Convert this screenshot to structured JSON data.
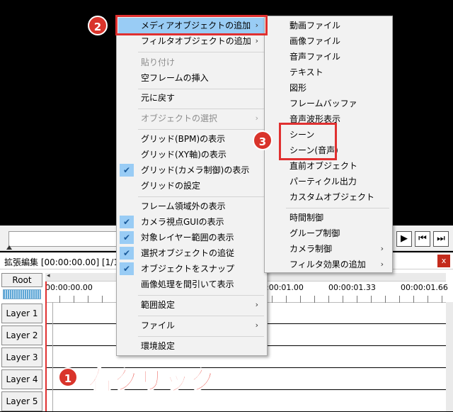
{
  "timeline": {
    "title": "拡張編集 [00:00:00.00] [1/1]",
    "close": "x",
    "root": "Root",
    "ticks": [
      "00:00:00.00",
      "00:00:01.00",
      "00:00:01.33",
      "00:00:01.66"
    ],
    "layers": [
      "Layer 1",
      "Layer 2",
      "Layer 3",
      "Layer 4",
      "Layer 5"
    ]
  },
  "playback": {
    "play": "▶",
    "prev": "⏮",
    "next": "⏭"
  },
  "menu": {
    "items": [
      {
        "label": "メディアオブジェクトの追加",
        "arrow": "›"
      },
      {
        "label": "フィルタオブジェクトの追加",
        "arrow": "›"
      },
      {
        "label": "貼り付け"
      },
      {
        "label": "空フレームの挿入"
      },
      {
        "label": "元に戻す"
      },
      {
        "label": "オブジェクトの選択",
        "arrow": "›"
      },
      {
        "label": "グリッド(BPM)の表示"
      },
      {
        "label": "グリッド(XY軸)の表示"
      },
      {
        "label": "グリッド(カメラ制御)の表示"
      },
      {
        "label": "グリッドの設定"
      },
      {
        "label": "フレーム領域外の表示"
      },
      {
        "label": "カメラ視点GUIの表示"
      },
      {
        "label": "対象レイヤー範囲の表示"
      },
      {
        "label": "選択オブジェクトの追従"
      },
      {
        "label": "オブジェクトをスナップ"
      },
      {
        "label": "画像処理を間引いて表示"
      },
      {
        "label": "範囲設定",
        "arrow": "›"
      },
      {
        "label": "ファイル",
        "arrow": "›"
      },
      {
        "label": "環境設定"
      }
    ],
    "check": "✔"
  },
  "submenu": {
    "items": [
      {
        "label": "動画ファイル"
      },
      {
        "label": "画像ファイル"
      },
      {
        "label": "音声ファイル"
      },
      {
        "label": "テキスト"
      },
      {
        "label": "図形"
      },
      {
        "label": "フレームバッファ"
      },
      {
        "label": "音声波形表示"
      },
      {
        "label": "シーン"
      },
      {
        "label": "シーン(音声)"
      },
      {
        "label": "直前オブジェクト"
      },
      {
        "label": "パーティクル出力"
      },
      {
        "label": "カスタムオブジェクト"
      },
      {
        "label": "時間制御"
      },
      {
        "label": "グループ制御"
      },
      {
        "label": "カメラ制御",
        "arrow": "›"
      },
      {
        "label": "フィルタ効果の追加",
        "arrow": "›"
      }
    ]
  },
  "annotations": {
    "step1": "1",
    "step2": "2",
    "step3": "3",
    "right_click": "右クリック"
  },
  "colors": {
    "highlight": "#99ccf5",
    "annotation_red": "#e03030"
  }
}
